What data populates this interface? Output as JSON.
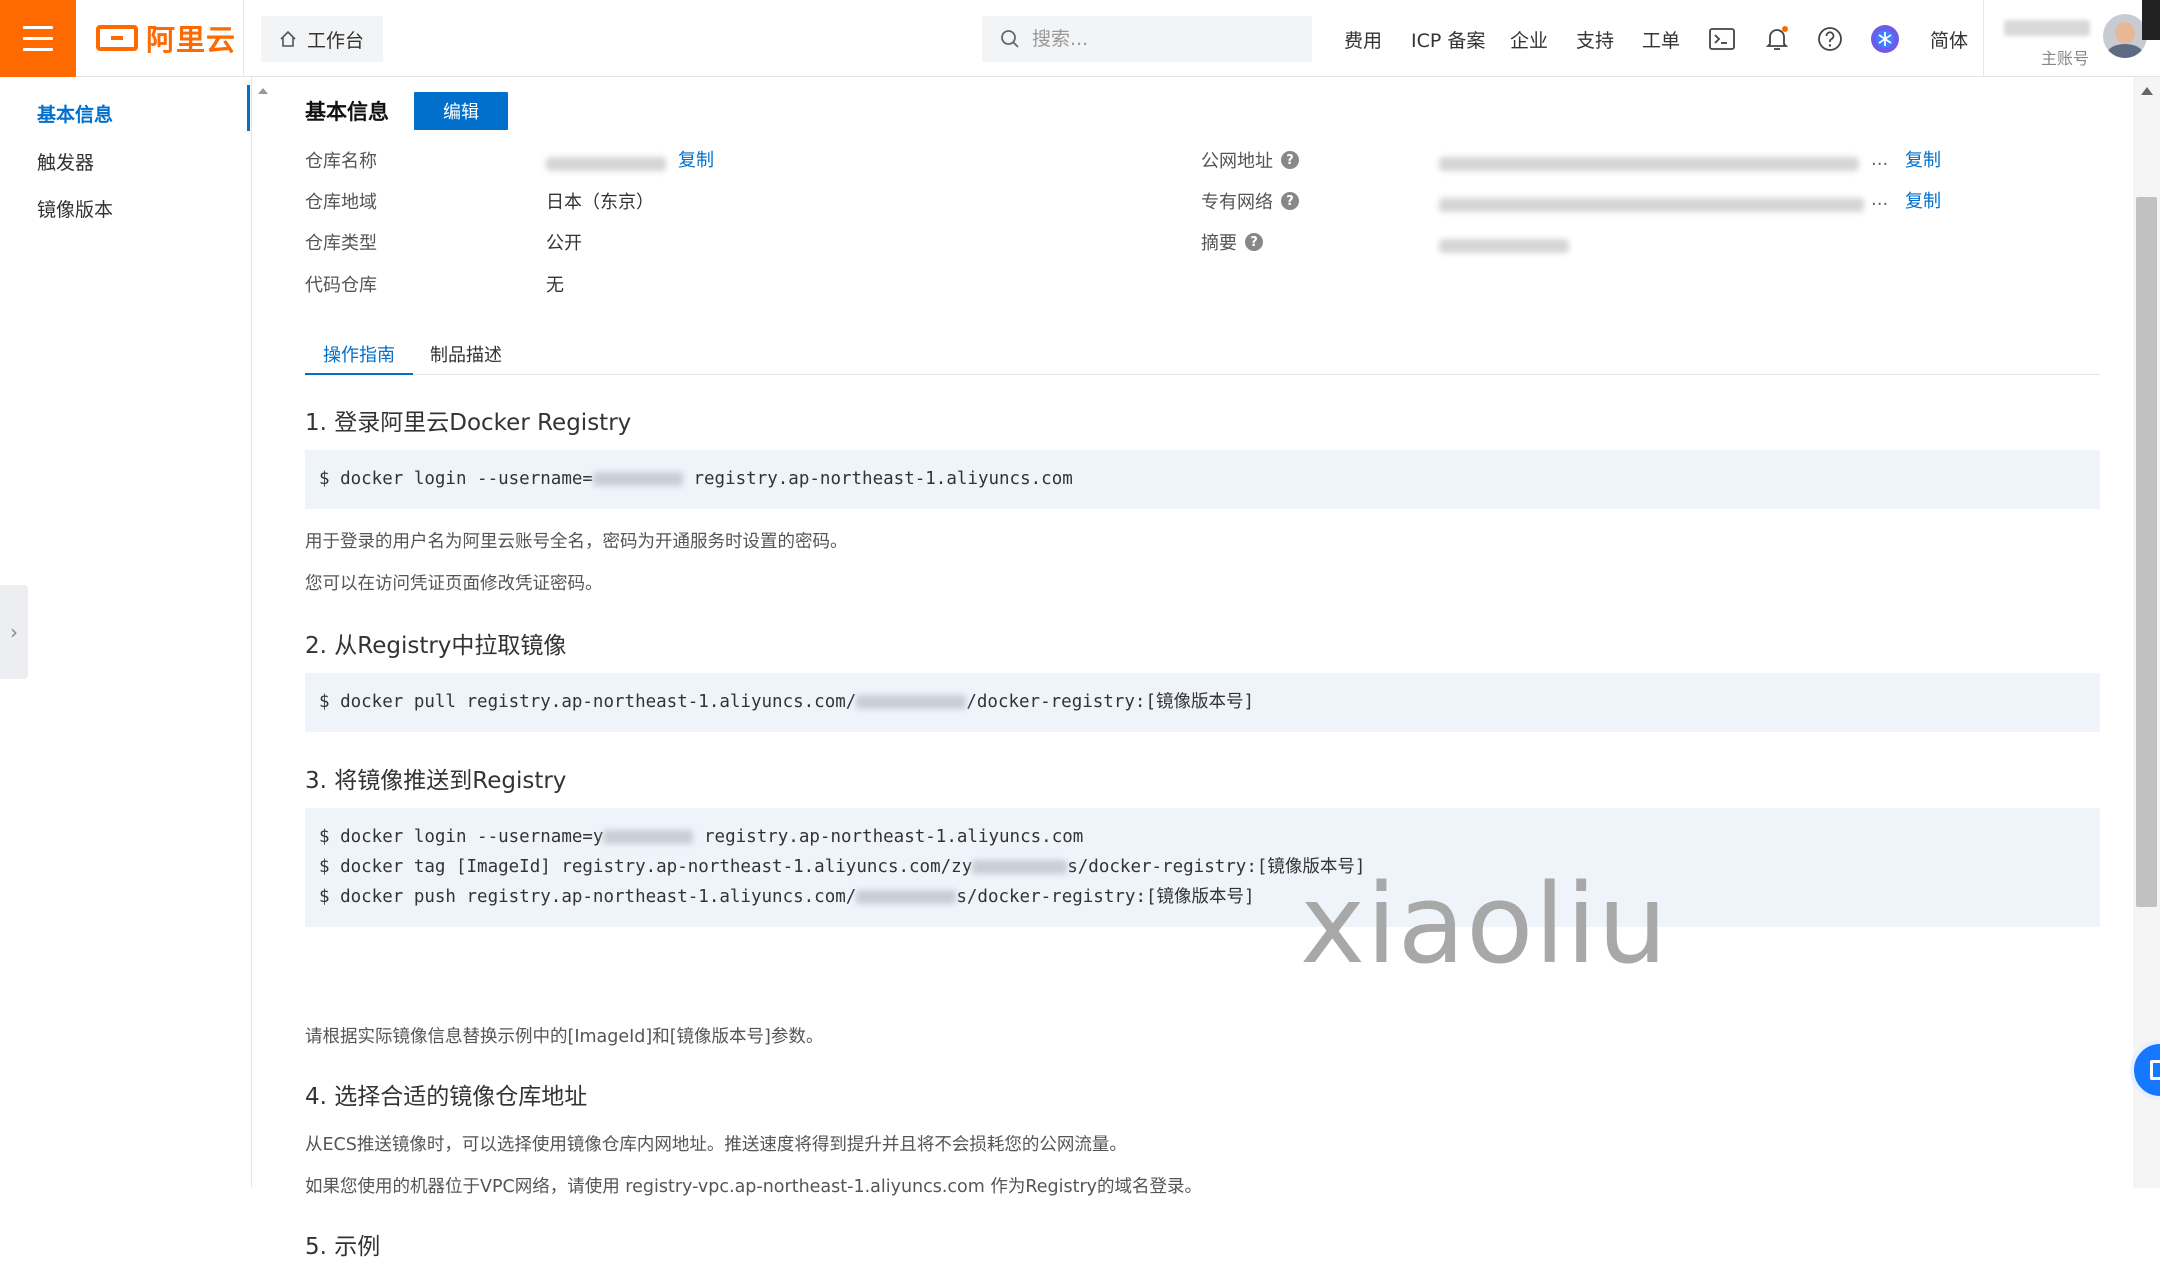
{
  "topbar": {
    "logo_text": "阿里云",
    "workbench_label": "工作台",
    "search_placeholder": "搜索...",
    "nav": {
      "fees": "费用",
      "icp": "ICP 备案",
      "enterprise": "企业",
      "support": "支持",
      "ticket": "工单",
      "lang": "简体"
    },
    "account_sub": "主账号",
    "accent_color": "#ff6a00"
  },
  "sidebar": {
    "items": [
      {
        "label": "基本信息",
        "active": true
      },
      {
        "label": "触发器",
        "active": false
      },
      {
        "label": "镜像版本",
        "active": false
      }
    ]
  },
  "basic_info": {
    "title": "基本信息",
    "edit_label": "编辑",
    "fields_left": [
      {
        "label": "仓库名称",
        "value": "",
        "copy": "复制"
      },
      {
        "label": "仓库地域",
        "value": "日本（东京）"
      },
      {
        "label": "仓库类型",
        "value": "公开"
      },
      {
        "label": "代码仓库",
        "value": "无"
      }
    ],
    "fields_right": [
      {
        "label": "公网地址",
        "value": "...",
        "copy": "复制"
      },
      {
        "label": "专有网络",
        "value": "...",
        "copy": "复制"
      },
      {
        "label": "摘要",
        "value": ""
      }
    ]
  },
  "tabs": [
    {
      "label": "操作指南",
      "active": true
    },
    {
      "label": "制品描述",
      "active": false
    }
  ],
  "guide": {
    "s1": {
      "title": "1. 登录阿里云Docker Registry",
      "code1_pre": "$ docker login --username=",
      "code1_post": " registry.ap-northeast-1.aliyuncs.com",
      "p1": "用于登录的用户名为阿里云账号全名，密码为开通服务时设置的密码。",
      "p2": "您可以在访问凭证页面修改凭证密码。"
    },
    "s2": {
      "title": "2. 从Registry中拉取镜像",
      "code_pre": "$ docker pull registry.ap-northeast-1.aliyuncs.com/",
      "code_post": "/docker-registry:[镜像版本号]"
    },
    "s3": {
      "title": "3. 将镜像推送到Registry",
      "l1_pre": "$ docker login --username=y",
      "l1_post": " registry.ap-northeast-1.aliyuncs.com",
      "l2_pre": "$ docker tag [ImageId] registry.ap-northeast-1.aliyuncs.com/zy",
      "l2_post": "s/docker-registry:[镜像版本号]",
      "l3_pre": "$ docker push registry.ap-northeast-1.aliyuncs.com/",
      "l3_post": "s/docker-registry:[镜像版本号]",
      "note": "请根据实际镜像信息替换示例中的[ImageId]和[镜像版本号]参数。"
    },
    "s4": {
      "title": "4. 选择合适的镜像仓库地址",
      "p1": "从ECS推送镜像时，可以选择使用镜像仓库内网地址。推送速度将得到提升并且将不会损耗您的公网流量。",
      "p2": "如果您使用的机器位于VPC网络，请使用 registry-vpc.ap-northeast-1.aliyuncs.com 作为Registry的域名登录。"
    },
    "s5": {
      "title": "5. 示例"
    }
  },
  "watermark": "xiaoliu"
}
